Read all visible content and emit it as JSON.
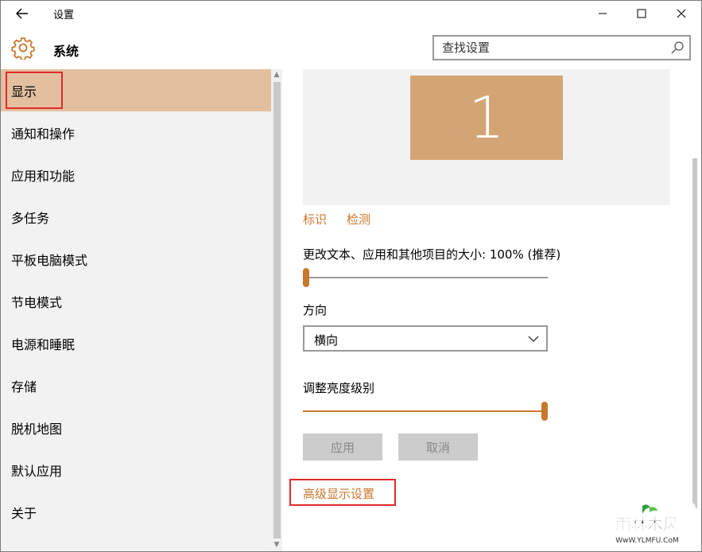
{
  "window": {
    "title": "设置"
  },
  "header": {
    "section_title": "系统",
    "search_placeholder": "查找设置"
  },
  "sidebar": {
    "items": [
      {
        "label": "显示",
        "active": true
      },
      {
        "label": "通知和操作"
      },
      {
        "label": "应用和功能"
      },
      {
        "label": "多任务"
      },
      {
        "label": "平板电脑模式"
      },
      {
        "label": "节电模式"
      },
      {
        "label": "电源和睡眠"
      },
      {
        "label": "存储"
      },
      {
        "label": "脱机地图"
      },
      {
        "label": "默认应用"
      },
      {
        "label": "关于"
      }
    ]
  },
  "main": {
    "monitor_label": "1",
    "identify_link": "标识",
    "detect_link": "检测",
    "scale_label": "更改文本、应用和其他项目的大小: 100% (推荐)",
    "scale_slider_value": 0,
    "orientation_label": "方向",
    "orientation_value": "横向",
    "brightness_label": "调整亮度级别",
    "brightness_slider_value": 100,
    "apply_button": "应用",
    "cancel_button": "取消",
    "advanced_link": "高级显示设置"
  },
  "watermark": {
    "text": "雨林木风",
    "url_text": "WwW.YLMFU.CoM"
  },
  "colors": {
    "accent": "#c8782c",
    "active_nav": "#e3bfa0",
    "monitor": "#d4a574",
    "highlight_box": "#e02a2a"
  }
}
